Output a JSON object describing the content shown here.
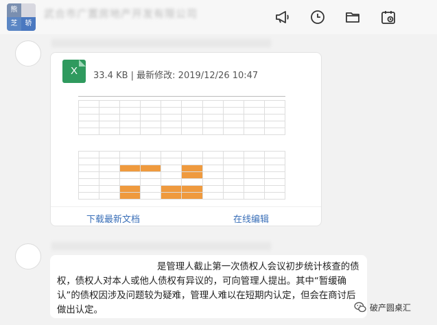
{
  "chat": {
    "title": "武合市广置房地产开发有限公司",
    "group_avatar_chars": [
      "熊",
      "",
      "芝",
      "轿"
    ]
  },
  "toolbar": {
    "icons": [
      "megaphone-icon",
      "clock-icon",
      "folder-icon",
      "calendar-icon"
    ]
  },
  "file_message": {
    "file_type_letter": "X",
    "meta": "33.4 KB | 最新修改: 2019/12/26 10:47",
    "download_label": "下载最新文档",
    "edit_label": "在线编辑"
  },
  "text_message": {
    "text": "是管理人截止第一次债权人会议初步统计核查的债权，债权人对本人或他人债权有异议的，可向管理人提出。其中“暂缓确认”的债权因涉及问题较为疑难，管理人难以在短期内认定，但会在商讨后做出认定。"
  },
  "watermark": {
    "label": "破产圆桌汇"
  },
  "colors": {
    "accent_link": "#3a6fb8",
    "excel_green": "#2f9a5e",
    "highlight_orange": "#ef9a3e"
  }
}
